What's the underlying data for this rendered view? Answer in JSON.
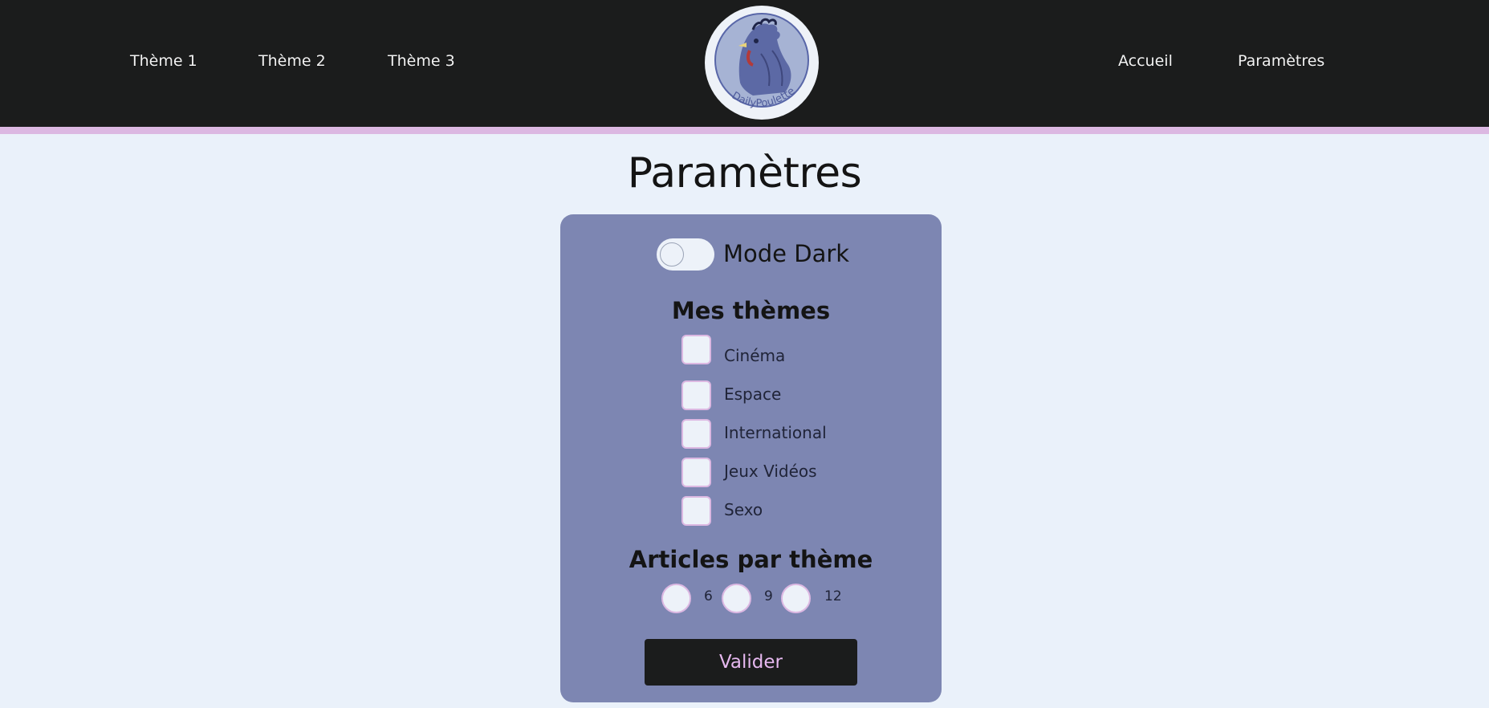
{
  "header": {
    "nav_left": [
      {
        "label": "Thème 1"
      },
      {
        "label": "Thème 2"
      },
      {
        "label": "Thème 3"
      }
    ],
    "nav_right": [
      {
        "label": "Accueil"
      },
      {
        "label": "Paramètres"
      }
    ],
    "logo": {
      "text": "DailyPoulette",
      "icon": "rooster-logo"
    }
  },
  "colors": {
    "header_bg": "#1b1c1c",
    "accent_pink": "#dcb8e2",
    "page_bg": "#eaf1fa",
    "panel_bg": "#7d86b2",
    "button_text": "#e6b8ef"
  },
  "page": {
    "title": "Paramètres"
  },
  "settings": {
    "dark_mode": {
      "label": "Mode Dark",
      "checked": false
    },
    "themes": {
      "title": "Mes thèmes",
      "options": [
        {
          "label": "Cinéma",
          "checked": false
        },
        {
          "label": "Espace",
          "checked": false
        },
        {
          "label": "International",
          "checked": false
        },
        {
          "label": "Jeux Vidéos",
          "checked": false
        },
        {
          "label": "Sexo",
          "checked": false
        }
      ]
    },
    "articles_per_theme": {
      "title": "Articles par thème",
      "options": [
        {
          "label": "6",
          "selected": false
        },
        {
          "label": "9",
          "selected": false
        },
        {
          "label": "12",
          "selected": false
        }
      ]
    },
    "submit_label": "Valider"
  }
}
